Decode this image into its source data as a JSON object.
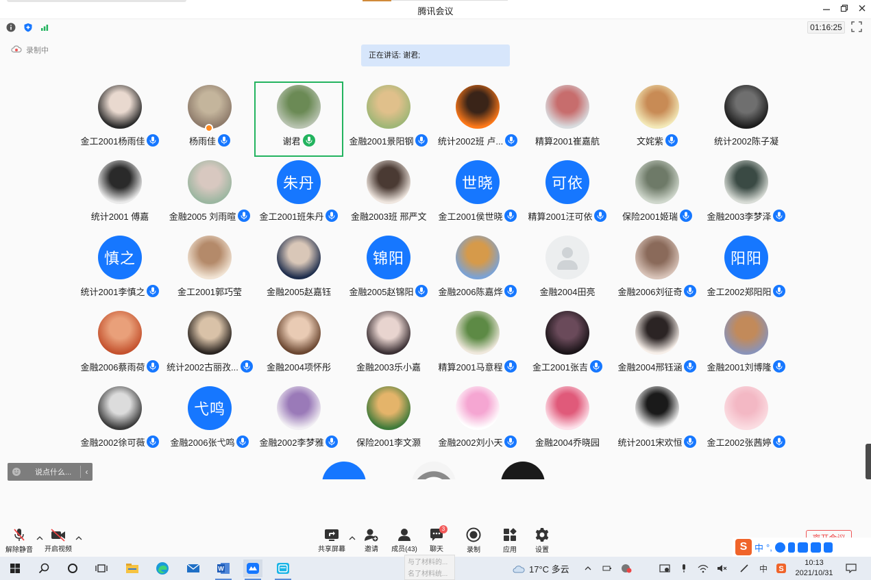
{
  "window": {
    "title": "腾讯会议",
    "timer": "01:16:25",
    "recording_status": "录制中",
    "speaking_label": "正在讲话: 谢君;"
  },
  "participants": [
    {
      "name": "金工2001杨雨佳",
      "avatar": {
        "kind": "photo",
        "colors": [
          "#2a2a2a",
          "#e9d9cf"
        ]
      },
      "mic": true
    },
    {
      "name": "杨雨佳",
      "avatar": {
        "kind": "photo",
        "colors": [
          "#8e7b6b",
          "#c4b59c"
        ]
      },
      "mic": true,
      "badge": true
    },
    {
      "name": "谢君",
      "avatar": {
        "kind": "photo",
        "colors": [
          "#b8c3b0",
          "#6b8a55"
        ]
      },
      "mic": true,
      "speaking": true
    },
    {
      "name": "金融2001景阳钢",
      "avatar": {
        "kind": "photo",
        "colors": [
          "#9fb676",
          "#e0c08b"
        ]
      },
      "mic": true
    },
    {
      "name": "统计2002班 卢...",
      "avatar": {
        "kind": "photo",
        "colors": [
          "#ff7a1a",
          "#3a2418"
        ]
      },
      "mic": true
    },
    {
      "name": "精算2001崔嘉航",
      "avatar": {
        "kind": "photo",
        "colors": [
          "#d9dcdf",
          "#c76d6d"
        ]
      },
      "mic": false
    },
    {
      "name": "文姹紫",
      "avatar": {
        "kind": "photo",
        "colors": [
          "#f3e9b8",
          "#c88b55"
        ]
      },
      "mic": true
    },
    {
      "name": "统计2002陈子凝",
      "avatar": {
        "kind": "photo",
        "colors": [
          "#1c1c1c",
          "#6f6f6f"
        ]
      },
      "mic": false
    },
    {
      "name": "统计2001 傅嘉",
      "avatar": {
        "kind": "photo",
        "colors": [
          "#eaeaea",
          "#2a2a2a"
        ]
      },
      "mic": false
    },
    {
      "name": "金融2005 刘雨暄",
      "avatar": {
        "kind": "photo",
        "colors": [
          "#9bb6a0",
          "#d8c8c0"
        ]
      },
      "mic": true
    },
    {
      "name": "金工2001班朱丹",
      "avatar": {
        "kind": "text",
        "text": "朱丹"
      },
      "mic": true
    },
    {
      "name": "金融2003班 邢严文",
      "avatar": {
        "kind": "photo",
        "colors": [
          "#efe6df",
          "#4a3a33"
        ]
      },
      "mic": false
    },
    {
      "name": "金工2001侯世晓",
      "avatar": {
        "kind": "text",
        "text": "世晓"
      },
      "mic": true
    },
    {
      "name": "精算2001汪可依",
      "avatar": {
        "kind": "text",
        "text": "可依"
      },
      "mic": true
    },
    {
      "name": "保险2001姬瑞",
      "avatar": {
        "kind": "photo",
        "colors": [
          "#cfd7cc",
          "#6e7a68"
        ]
      },
      "mic": true
    },
    {
      "name": "金融2003李梦泽",
      "avatar": {
        "kind": "photo",
        "colors": [
          "#d8dcd6",
          "#3a4a44"
        ]
      },
      "mic": true
    },
    {
      "name": "统计2001李慎之",
      "avatar": {
        "kind": "text",
        "text": "慎之"
      },
      "mic": true
    },
    {
      "name": "金工2001郭巧莹",
      "avatar": {
        "kind": "photo",
        "colors": [
          "#f1e3d3",
          "#b48a6a"
        ]
      },
      "mic": false
    },
    {
      "name": "金融2005赵嘉钰",
      "avatar": {
        "kind": "photo",
        "colors": [
          "#1e2d4c",
          "#d9c7b8"
        ]
      },
      "mic": false
    },
    {
      "name": "金融2005赵锦阳",
      "avatar": {
        "kind": "text",
        "text": "锦阳"
      },
      "mic": true
    },
    {
      "name": "金融2006陈嘉烨",
      "avatar": {
        "kind": "photo",
        "colors": [
          "#7aa2d6",
          "#d69a4a"
        ]
      },
      "mic": true
    },
    {
      "name": "金融2004田亮",
      "avatar": {
        "kind": "default"
      },
      "mic": false
    },
    {
      "name": "金融2006刘征奇",
      "avatar": {
        "kind": "photo",
        "colors": [
          "#d8c3b8",
          "#8a6a5a"
        ]
      },
      "mic": true
    },
    {
      "name": "金工2002郑阳阳",
      "avatar": {
        "kind": "text",
        "text": "阳阳"
      },
      "mic": true
    },
    {
      "name": "金融2006蔡雨荷",
      "avatar": {
        "kind": "photo",
        "colors": [
          "#c4522e",
          "#e9a07a"
        ]
      },
      "mic": true
    },
    {
      "name": "统计2002古丽孜...",
      "avatar": {
        "kind": "photo",
        "colors": [
          "#2a2420",
          "#d9c2a8"
        ]
      },
      "mic": true
    },
    {
      "name": "金融2004项怀彤",
      "avatar": {
        "kind": "photo",
        "colors": [
          "#6a4630",
          "#e9cbb4"
        ]
      },
      "mic": false
    },
    {
      "name": "金融2003乐小嘉",
      "avatar": {
        "kind": "photo",
        "colors": [
          "#3a2f33",
          "#e8d4cf"
        ]
      },
      "mic": false
    },
    {
      "name": "精算2001马意程",
      "avatar": {
        "kind": "photo",
        "colors": [
          "#efe8dc",
          "#5d8a45"
        ]
      },
      "mic": true
    },
    {
      "name": "金工2001张吉",
      "avatar": {
        "kind": "photo",
        "colors": [
          "#1a1418",
          "#6a4a5a"
        ]
      },
      "mic": true
    },
    {
      "name": "金融2004邢钰涵",
      "avatar": {
        "kind": "photo",
        "colors": [
          "#f7efe9",
          "#2b2424"
        ]
      },
      "mic": true
    },
    {
      "name": "金融2001刘博隆",
      "avatar": {
        "kind": "photo",
        "colors": [
          "#8a93b8",
          "#c28a5a"
        ]
      },
      "mic": true
    },
    {
      "name": "金融2002徐可薇",
      "avatar": {
        "kind": "photo",
        "colors": [
          "#3a3a3a",
          "#dcdcdc"
        ]
      },
      "mic": true
    },
    {
      "name": "金融2006张弋鸣",
      "avatar": {
        "kind": "text",
        "text": "弋鸣"
      },
      "mic": true
    },
    {
      "name": "金融2002李梦雅",
      "avatar": {
        "kind": "photo",
        "colors": [
          "#f1eef3",
          "#9a7ab8"
        ]
      },
      "mic": true
    },
    {
      "name": "保险2001李文灏",
      "avatar": {
        "kind": "photo",
        "colors": [
          "#3f7a3a",
          "#e4b46a"
        ]
      },
      "mic": false
    },
    {
      "name": "金融2002刘小天",
      "avatar": {
        "kind": "photo",
        "colors": [
          "#ffffff",
          "#f5a6d2"
        ]
      },
      "mic": true
    },
    {
      "name": "金融2004乔晓园",
      "avatar": {
        "kind": "photo",
        "colors": [
          "#fde1ea",
          "#e05a7a"
        ]
      },
      "mic": false
    },
    {
      "name": "统计2001宋欢恒",
      "avatar": {
        "kind": "photo",
        "colors": [
          "#f4f4f4",
          "#1a1a1a"
        ]
      },
      "mic": true
    },
    {
      "name": "金工2002张茜婷",
      "avatar": {
        "kind": "photo",
        "colors": [
          "#fbdde2",
          "#f3b8c4"
        ]
      },
      "mic": true
    }
  ],
  "chat": {
    "placeholder": "说点什么...",
    "collapse_glyph": "‹"
  },
  "toolbar": {
    "unmute_label": "解除静音",
    "video_label": "开启视频",
    "share_label": "共享屏幕",
    "invite_label": "邀请",
    "members_label": "成员(43)",
    "chat_label": "聊天",
    "chat_badge": "3",
    "record_label": "录制",
    "apps_label": "应用",
    "settings_label": "设置",
    "leave_label": "离开会议"
  },
  "ime": {
    "logo": "S",
    "mode": "中",
    "punct": "°,"
  },
  "taskbar": {
    "weather": "17°C 多云",
    "time": "10:13",
    "date": "2021/10/31",
    "lang": "中",
    "ghost_text_1": "与了材料的...",
    "ghost_text_2": "名了材料统..."
  },
  "colors": {
    "accent_blue": "#1677ff",
    "speaking_green": "#22b35e",
    "speaking_banner": "#d7e6fb",
    "leave_red": "#e44444"
  }
}
